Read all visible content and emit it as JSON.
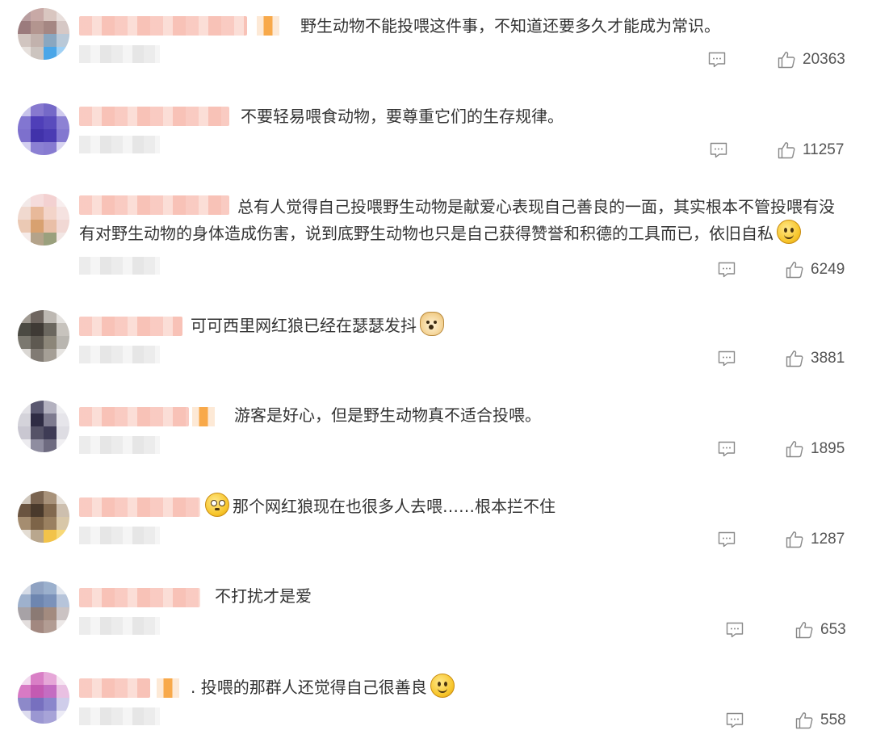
{
  "comments": [
    {
      "text": "野生动物不能投喂这件事，不知道还要多久才能成为常识。",
      "likes": "20363",
      "has_badge": true,
      "emoji_before": "",
      "emoji_after": ""
    },
    {
      "text": "不要轻易喂食动物，要尊重它们的生存规律。",
      "likes": "11257",
      "has_badge": false,
      "emoji_before": "",
      "emoji_after": ""
    },
    {
      "text": "总有人觉得自己投喂野生动物是献爱心表现自己善良的一面，其实根本不管投喂有没有对野生动物的身体造成伤害，说到底野生动物也只是自己获得赞誉和积德的工具而已，依旧自私",
      "likes": "6249",
      "has_badge": false,
      "emoji_before": "",
      "emoji_after": "smile-emoji"
    },
    {
      "text": "可可西里网红狼已经在瑟瑟发抖",
      "likes": "3881",
      "has_badge": false,
      "emoji_before": "",
      "emoji_after": "doge-emoji"
    },
    {
      "text": "游客是好心，但是野生动物真不适合投喂。",
      "likes": "1895",
      "has_badge": true,
      "emoji_before": "",
      "emoji_after": ""
    },
    {
      "text": "那个网红狼现在也很多人去喂……根本拦不住",
      "likes": "1287",
      "has_badge": false,
      "emoji_before": "flushed-emoji",
      "emoji_after": ""
    },
    {
      "text": "不打扰才是爱",
      "likes": "653",
      "has_badge": false,
      "emoji_before": "",
      "emoji_after": ""
    },
    {
      "text": ". 投喂的那群人还觉得自己很善良",
      "likes": "558",
      "has_badge": true,
      "emoji_before": "",
      "emoji_after": "smile-emoji"
    }
  ],
  "icons": {
    "reply": "comment-icon",
    "like": "thumbs-up-icon"
  },
  "colors": {
    "text": "#333333",
    "count": "#555555",
    "icon": "#888888"
  }
}
